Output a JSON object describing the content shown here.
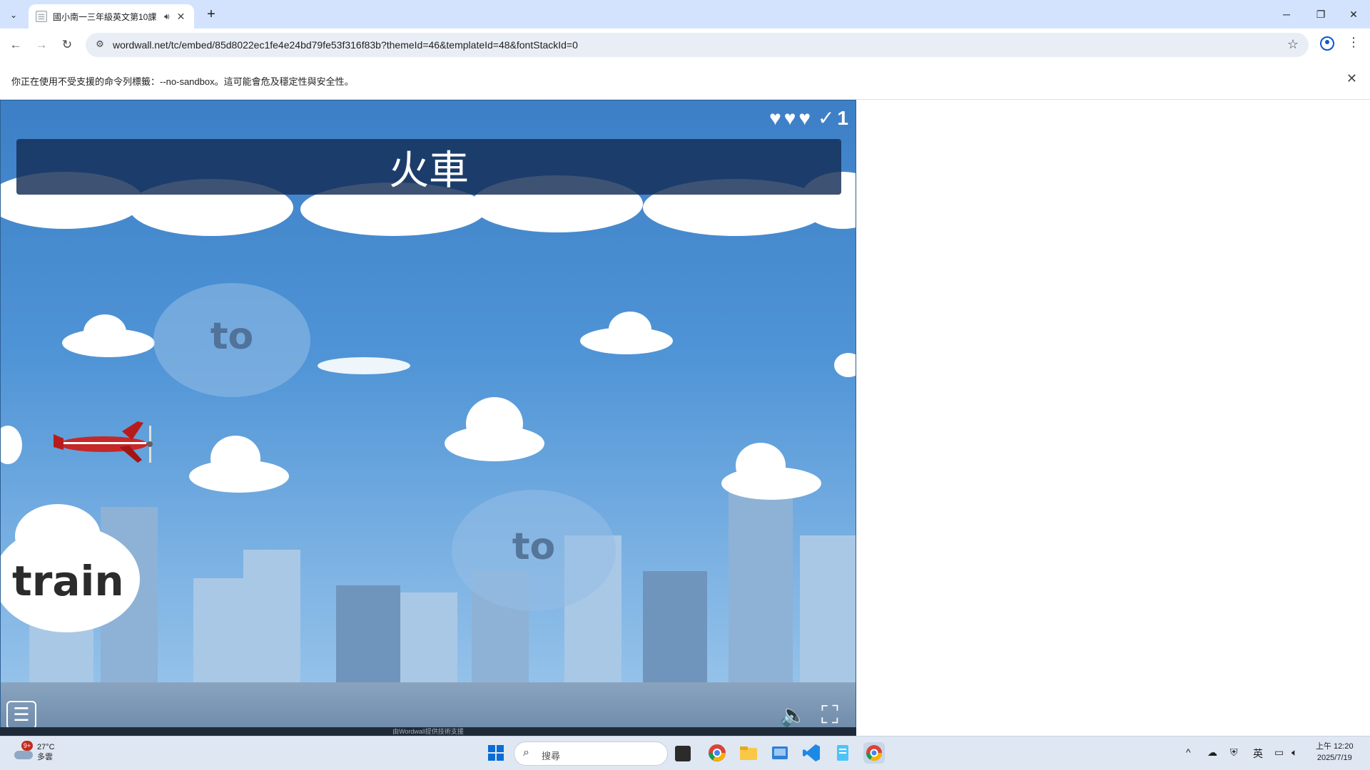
{
  "browser": {
    "tab": {
      "title": "國小南一三年級英文第10課",
      "audio_icon": "speaker-icon",
      "close_icon": "close-icon"
    },
    "new_tab_label": "+",
    "window_controls": {
      "minimize": "─",
      "restore": "❐",
      "close": "✕"
    },
    "nav": {
      "back": "←",
      "forward": "→",
      "reload": "↻"
    },
    "url": "wordwall.net/tc/embed/85d8022ec1fe4e24bd79fe53f316f83b?themeId=46&templateId=48&fontStackId=0",
    "bookmark_star": "☆",
    "menu": "⋮"
  },
  "infobar": {
    "message": "你正在使用不受支援的命令列標籤：--no-sandbox。這可能會危及穩定性與安全性。",
    "close": "✕"
  },
  "game": {
    "lives": [
      "♥",
      "♥",
      "♥"
    ],
    "check_mark": "✓",
    "score": "1",
    "prompt": "火車",
    "word_clouds": [
      {
        "text": "to"
      },
      {
        "text": "to"
      }
    ],
    "answer_word": "train",
    "menu_icon": "☰",
    "sound_icon": "🔈",
    "fullscreen_icon": "⛶",
    "credit": "由Wordwall提供技術支援"
  },
  "taskbar": {
    "weather": {
      "temp": "27°C",
      "condition": "多雲",
      "badge": "9+"
    },
    "search_placeholder": "搜尋",
    "tray": {
      "chevron": "^",
      "ime": "英"
    },
    "clock": {
      "time": "上午 12:20",
      "date": "2025/7/19"
    }
  },
  "colors": {
    "tabstrip": "#d3e3fd",
    "sky": "#4f94d6",
    "prompt_bg": "#142d55",
    "plane": "#c62828"
  }
}
